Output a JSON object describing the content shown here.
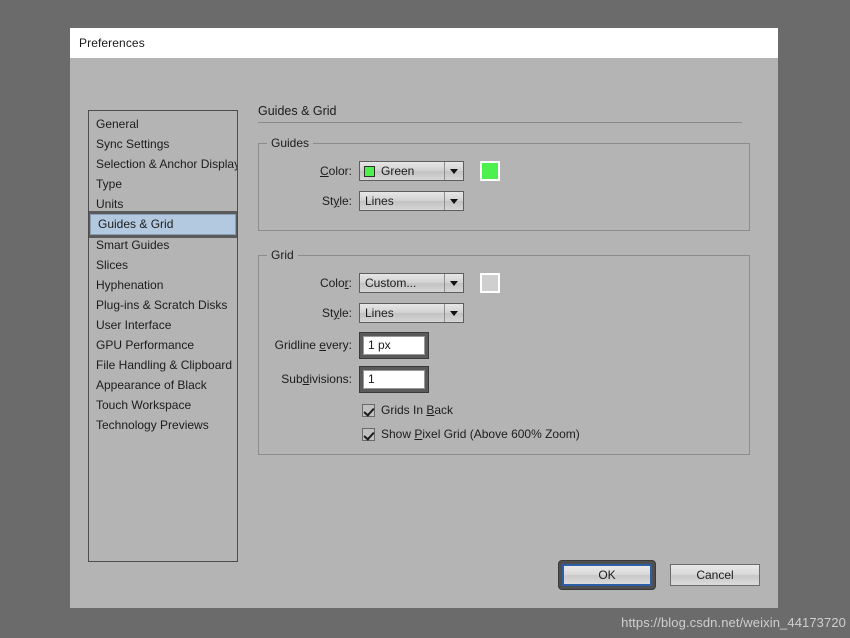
{
  "window": {
    "title": "Preferences"
  },
  "sidebar": {
    "items": [
      {
        "label": "General",
        "selected": false
      },
      {
        "label": "Sync Settings",
        "selected": false
      },
      {
        "label": "Selection & Anchor Display",
        "selected": false
      },
      {
        "label": "Type",
        "selected": false
      },
      {
        "label": "Units",
        "selected": false
      },
      {
        "label": "Guides & Grid",
        "selected": true
      },
      {
        "label": "Smart Guides",
        "selected": false
      },
      {
        "label": "Slices",
        "selected": false
      },
      {
        "label": "Hyphenation",
        "selected": false
      },
      {
        "label": "Plug-ins & Scratch Disks",
        "selected": false
      },
      {
        "label": "User Interface",
        "selected": false
      },
      {
        "label": "GPU Performance",
        "selected": false
      },
      {
        "label": "File Handling & Clipboard",
        "selected": false
      },
      {
        "label": "Appearance of Black",
        "selected": false
      },
      {
        "label": "Touch Workspace",
        "selected": false
      },
      {
        "label": "Technology Previews",
        "selected": false
      }
    ]
  },
  "panel": {
    "title": "Guides & Grid",
    "guides": {
      "legend": "Guides",
      "color_label": "Color:",
      "color_value": "Green",
      "color_hex": "#4ef04e",
      "preview_hex": "#4ef04e",
      "style_label": "Style:",
      "style_value": "Lines"
    },
    "grid": {
      "legend": "Grid",
      "color_label": "Color:",
      "color_value": "Custom...",
      "color_hex": "#cfcfcf",
      "preview_hex": "#cfcfcf",
      "style_label": "Style:",
      "style_value": "Lines",
      "gridline_label": "Gridline every:",
      "gridline_value": "1 px",
      "subdivisions_label": "Subdivisions:",
      "subdivisions_value": "1",
      "grids_in_back_label": "Grids In Back",
      "grids_in_back_checked": true,
      "show_pixel_grid_label": "Show Pixel Grid (Above 600% Zoom)",
      "show_pixel_grid_checked": true
    }
  },
  "buttons": {
    "ok": "OK",
    "cancel": "Cancel"
  },
  "watermark": {
    "text": "https://blog.csdn.net/weixin_44173720"
  }
}
